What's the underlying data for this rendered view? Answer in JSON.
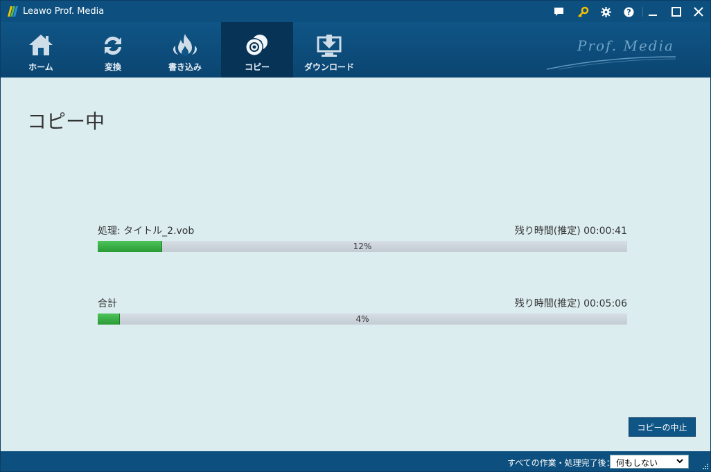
{
  "app": {
    "title": "Leawo Prof. Media"
  },
  "titlebar": {
    "icons": [
      "chat-icon",
      "key-icon",
      "gear-icon",
      "help-icon",
      "minimize-icon",
      "maximize-icon",
      "close-icon"
    ]
  },
  "nav": {
    "tabs": [
      {
        "label": "ホーム",
        "icon": "home-icon"
      },
      {
        "label": "変換",
        "icon": "convert-icon"
      },
      {
        "label": "書き込み",
        "icon": "burn-icon"
      },
      {
        "label": "コピー",
        "icon": "disc-copy-icon",
        "active": true
      },
      {
        "label": "ダウンロード",
        "icon": "download-icon"
      }
    ],
    "brand": "Prof. Media"
  },
  "main": {
    "heading": "コピー中",
    "current": {
      "label": "処理: タイトル_2.vob",
      "time": "残り時間(推定) 00:00:41",
      "progress_text": "12%",
      "progress": 0.12
    },
    "total": {
      "label": "合計",
      "time": "残り時間(推定) 00:05:06",
      "progress_text": "4%",
      "progress": 0.04
    },
    "stop_button": "コピーの中止"
  },
  "footer": {
    "after_label": "すべての作業・処理完了後：",
    "after_value": "何もしない"
  },
  "colors": {
    "accent": "#0d4f7e",
    "progress": "#2ea83a",
    "background": "#dcedf0"
  }
}
